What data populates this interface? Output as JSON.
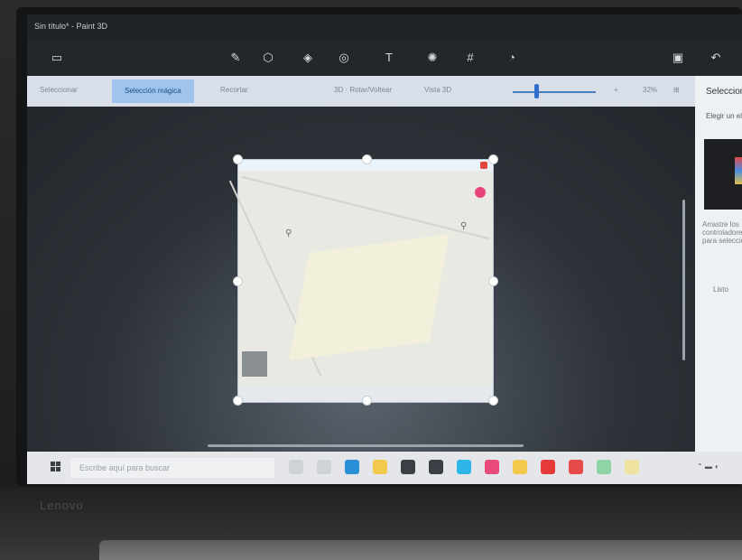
{
  "window": {
    "title": "Sin título* - Paint 3D"
  },
  "toolbar": {
    "tools": [
      {
        "name": "brushes-icon",
        "glyph": "✎"
      },
      {
        "name": "shapes-2d-icon",
        "glyph": "⬡"
      },
      {
        "name": "shapes-3d-icon",
        "glyph": "◈"
      },
      {
        "name": "stickers-icon",
        "glyph": "◎"
      },
      {
        "name": "text-icon",
        "glyph": "T"
      },
      {
        "name": "effects-icon",
        "glyph": "✺"
      },
      {
        "name": "canvas-icon",
        "glyph": "#"
      },
      {
        "name": "library-icon",
        "glyph": "◔"
      }
    ]
  },
  "commandbar": {
    "select": "Seleccionar",
    "magic_select": "Selección mágica",
    "crop": "Recortar",
    "flip": "3D · Rotar/Voltear",
    "view3d": "Vista 3D",
    "zoom_pct": "32%"
  },
  "sidepanel": {
    "title": "Seleccionar",
    "subtitle": "Elegir un elemento",
    "text": "Arrastre los controladores para seleccionar",
    "link": "Listo"
  },
  "taskbar": {
    "search_placeholder": "Escribe aquí para buscar",
    "icons": [
      {
        "name": "cortana-icon",
        "color": "#cfd3d8"
      },
      {
        "name": "task-view-icon",
        "color": "#cfd3d8"
      },
      {
        "name": "edge-icon",
        "color": "#2a8fd6"
      },
      {
        "name": "explorer-icon",
        "color": "#f2c94c"
      },
      {
        "name": "camera-icon",
        "color": "#3a3f46"
      },
      {
        "name": "mail-icon",
        "color": "#3a3f46"
      },
      {
        "name": "store-icon",
        "color": "#2fb6e8"
      },
      {
        "name": "media-icon",
        "color": "#e84a7a"
      },
      {
        "name": "chrome-icon",
        "color": "#f2c94c"
      },
      {
        "name": "opera-icon",
        "color": "#e63a3a"
      },
      {
        "name": "acrobat-icon",
        "color": "#e84a4a"
      },
      {
        "name": "paint3d-icon",
        "color": "#8fd4a4"
      },
      {
        "name": "people-icon",
        "color": "#f0e2a0"
      }
    ]
  },
  "brand": {
    "logo": "Lenovo"
  },
  "colors": {
    "accent": "#9fc4ee",
    "titlebar": "#1f2226"
  }
}
